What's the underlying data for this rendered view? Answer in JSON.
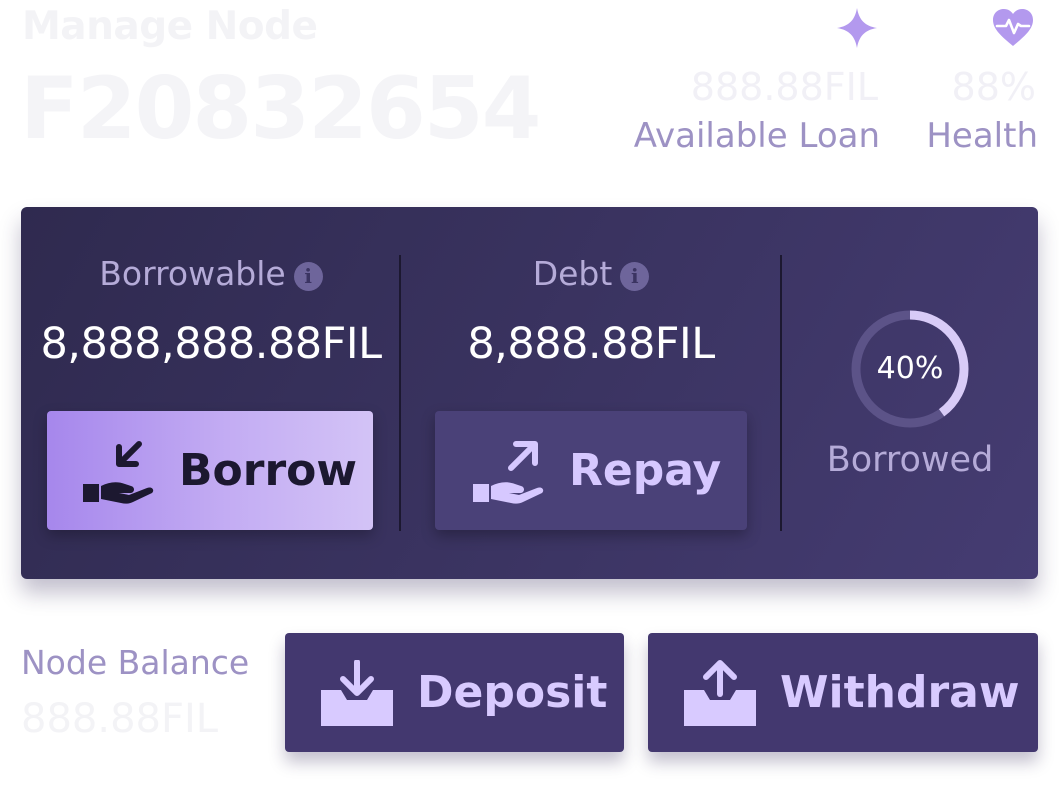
{
  "header": {
    "subtitle": "Manage Node",
    "node_id": "F20832654",
    "available_loan": {
      "value": "888.88FIL",
      "label": "Available Loan",
      "icon": "sparkle-icon"
    },
    "health": {
      "value": "88%",
      "label": "Health",
      "icon": "heart-pulse-icon"
    }
  },
  "card": {
    "borrowable": {
      "title": "Borrowable",
      "info": "i",
      "value": "8,888,888.88FIL"
    },
    "debt": {
      "title": "Debt",
      "info": "i",
      "value": "8,888.88FIL"
    },
    "borrow_button": {
      "label": "Borrow",
      "icon": "hand-receive-icon"
    },
    "repay_button": {
      "label": "Repay",
      "icon": "hand-give-icon"
    },
    "borrowed": {
      "percent_label": "40%",
      "percent": 40,
      "label": "Borrowed"
    }
  },
  "node_balance": {
    "label": "Node Balance",
    "value": "888.88FIL"
  },
  "deposit_button": {
    "label": "Deposit",
    "icon": "tray-download-icon"
  },
  "withdraw_button": {
    "label": "Withdraw",
    "icon": "tray-upload-icon"
  },
  "colors": {
    "card_bg": "#3b3462",
    "accent": "#a687ec",
    "button_dark": "#43386f",
    "label_muted": "#9d92c4"
  }
}
